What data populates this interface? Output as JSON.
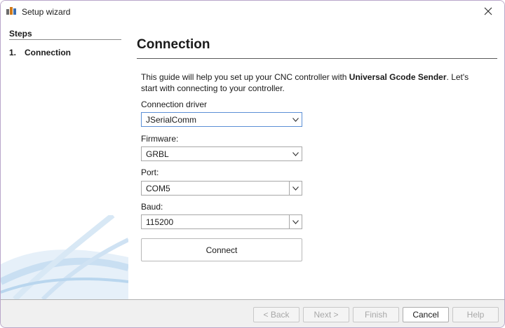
{
  "window": {
    "title": "Setup wizard",
    "app_icon": "ugs-logo-icon",
    "close_icon": "close-icon"
  },
  "steps": {
    "title": "Steps",
    "items": [
      {
        "number": "1.",
        "label": "Connection"
      }
    ]
  },
  "page": {
    "title": "Connection",
    "intro_before": "This guide will help you set up your CNC controller with ",
    "intro_bold": "Universal Gcode Sender",
    "intro_after": ". Let's start with connecting to your controller."
  },
  "fields": {
    "driver": {
      "label": "Connection driver",
      "value": "JSerialComm"
    },
    "firmware": {
      "label": "Firmware:",
      "value": "GRBL"
    },
    "port": {
      "label": "Port:",
      "value": "COM5"
    },
    "baud": {
      "label": "Baud:",
      "value": "115200"
    }
  },
  "connect_label": "Connect",
  "footer": {
    "back": "< Back",
    "next": "Next >",
    "finish": "Finish",
    "cancel": "Cancel",
    "help": "Help"
  },
  "colors": {
    "focus_border": "#5b8fd6",
    "decor_blue": "#b9d6ee"
  }
}
